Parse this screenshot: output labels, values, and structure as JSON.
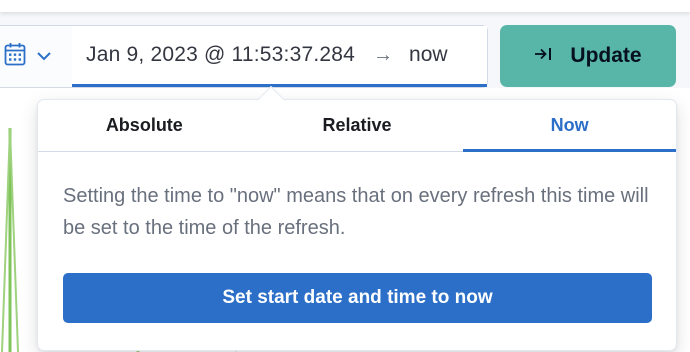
{
  "picker": {
    "start": "Jan 9, 2023 @ 11:53:37.284",
    "arrow": "→",
    "end": "now"
  },
  "update": {
    "label": "Update"
  },
  "popover": {
    "tabs": [
      {
        "label": "Absolute",
        "active": false
      },
      {
        "label": "Relative",
        "active": false
      },
      {
        "label": "Now",
        "active": true
      }
    ],
    "description": "Setting the time to \"now\" means that on every refresh this time will be set to the time of the refresh.",
    "button": "Set start date and time to now"
  },
  "colors": {
    "accent": "#2c6fc8",
    "update_button": "#58b6a8",
    "chart_line": "#7fc45a"
  }
}
